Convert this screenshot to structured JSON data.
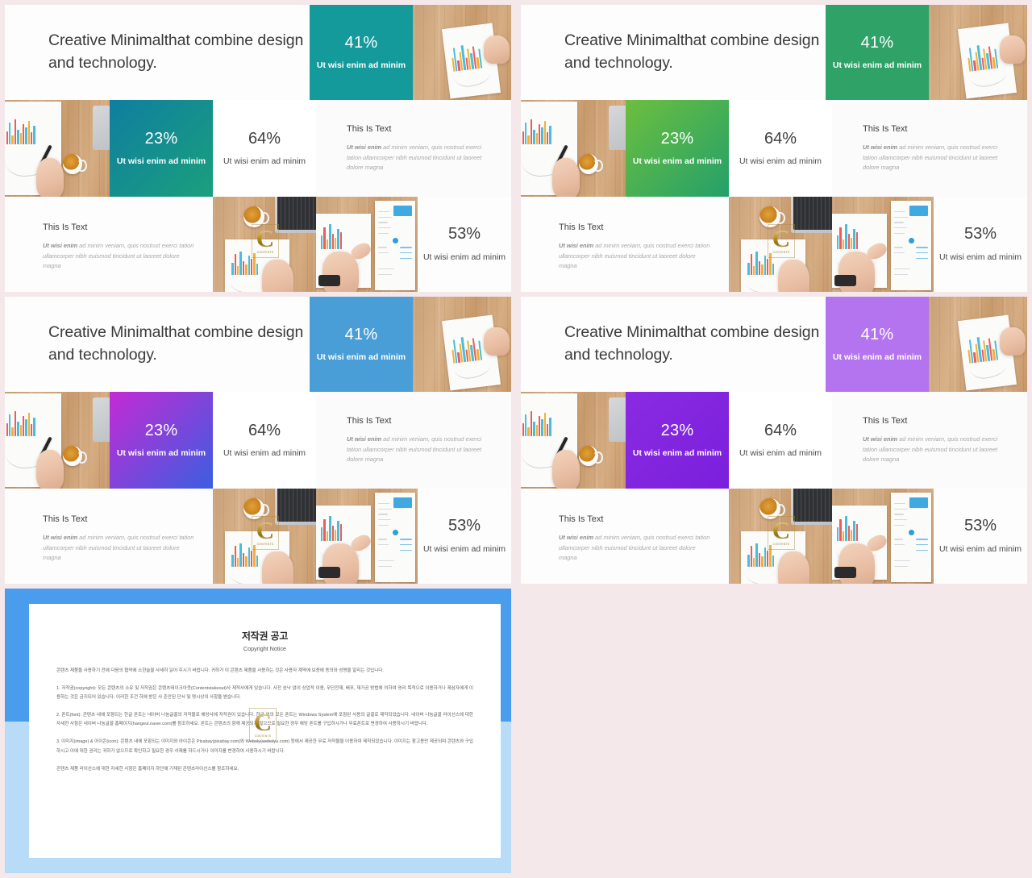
{
  "page": {
    "background_color": "#f5e8ea"
  },
  "slide_common": {
    "headline": "Creative Minimalthat combine design and technology.",
    "stat_41": {
      "value": "41%",
      "caption": "Ut wisi enim ad minim"
    },
    "stat_23": {
      "value": "23%",
      "caption": "Ut wisi enim ad minim"
    },
    "stat_64": {
      "value": "64%",
      "caption": "Ut wisi enim ad minim"
    },
    "stat_53": {
      "value": "53%",
      "caption": "Ut wisi enim ad minim"
    },
    "text_block_right": {
      "title": "This Is Text",
      "body_lead": "Ut wisi enim",
      "body": " ad minim veniam, quis nostrud exerci tation ullamcorper nibh euismod tincidunt ut laoreet dolore magna"
    },
    "text_block_left": {
      "title": "This Is Text",
      "body_lead": "Ut wisi enim",
      "body": " ad minim veniam, quis nostrud exerci tation ullamcorper nibh euismod tincidunt ut laoreet dolore magna"
    },
    "watermark": {
      "letter": "C",
      "label": "CONTENTS"
    }
  },
  "slides": [
    {
      "id": "slide-1",
      "theme_name": "teal",
      "color_41": "#159a9c",
      "color_23_from": "#0f7ea0",
      "color_23_to": "#1aa07c"
    },
    {
      "id": "slide-2",
      "theme_name": "green",
      "color_41": "#2fa268",
      "color_23_from": "#6cbf3e",
      "color_23_to": "#24a06a"
    },
    {
      "id": "slide-3",
      "theme_name": "blue-magenta",
      "color_41": "#4a9ed8",
      "color_23_from": "#c52ad4",
      "color_23_to": "#3b5ee0"
    },
    {
      "id": "slide-4",
      "theme_name": "purple",
      "color_41": "#b474f0",
      "color_23_from": "#8a2be2",
      "color_23_to": "#7a1fdc"
    }
  ],
  "copyright_slide": {
    "band_color_top": "#4a9ced",
    "band_color_bottom": "#b8dcf8",
    "title": "저작권 공고",
    "subtitle": "Copyright Notice",
    "paragraphs": [
      "콘텐츠 제품을 사용하기 전에 다음의 협약에 소한늘을 사세히 읽어 주시기 바랍니다. 귀하가 이 콘텐츠 제품을 사용하는 것은 사용자 계약에 보증에 동의와 성명을 알리는 것입니다.",
      "1. 저작권(copyright): 모든 콘텐츠의 소유 및 저작권은 콘텐츠테이크아웃(Contentstakeout)사 제작사에게 있습니다. 사전 승낙 없이 상업적 이용, 무단전재, 배포, 재가공 방법에 의하여 영리 목적으로 이용하거나 제삼자에게 이용하는 것은 금지되어 있습니다. 이러한 조건 하에 받은 사 존안된 단서 및 명시상의 사항을 받습니다.",
      "2. 폰트(font): 콘텐츠 내에 포함되는 한글 폰트는 네이버 나눔글꼴의 저작물로 해당사에 저작권이 있습니다. 한글 외의 모든 폰트는 Windows System에 포함된 사용의 글꼴로 제작되었습니다. 네이버 나눔글꼴 라이선스에 대한 자세한 사항은 네이버 나눔글꼴 홈페이지(hangeul.naver.com)를 참조하세요. 폰트는 콘텐츠의 함께 제공되지 않으므로 필요한 경우 해당 폰트를 구입하시거나 무료폰트로 변경하여 사용하시기 바랍니다.",
      "3. 이미지(image) & 아이콘(icon): 콘텐츠 내에 포함되는 이미지와 아이콘은 Pixabay(pixabay.com)와 Weboly(webolyu.com) 등에서 제공한 무료 저작물을 이용하여 제작되었습니다. 이미지는 참고용만 제공되며 콘텐츠와 구입하시고 이에 대한 권리는 귀하가 없으므로 확인하고 필요한 경우 삭제를 하드시거나 이미지를 변경하여 사용하시기 바랍니다.",
      "콘텐츠 제품 라이선스에 대한 자세한 사항은 홈페이지 하단에 기재된 콘텐츠라이선스를 참조하세요."
    ]
  }
}
